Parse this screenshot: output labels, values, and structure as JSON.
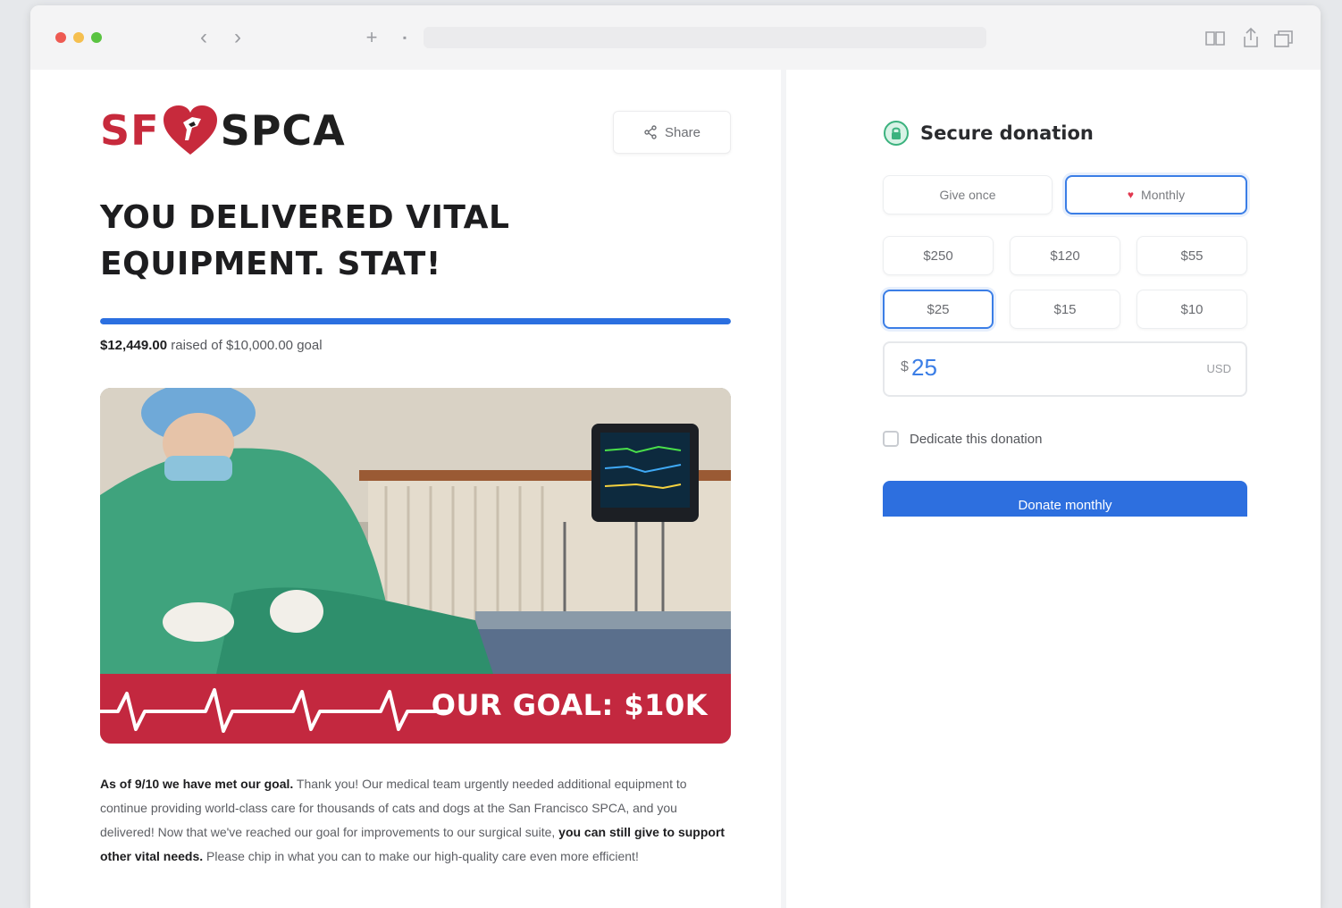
{
  "browser": {
    "traffic_lights": [
      "#ee5a52",
      "#f5bf4f",
      "#5ac341"
    ],
    "back_icon": "chevron-left",
    "forward_icon": "chevron-right",
    "reader_icon": "book",
    "share_icon": "share-up",
    "tabs_icon": "tabs"
  },
  "page": {
    "logo_sf": "SF",
    "logo_spca": "SPCA",
    "share_label": "Share",
    "headline": "YOU DELIVERED VITAL EQUIPMENT. STAT!",
    "progress_fraction": 1.0,
    "raised_amount": "$12,449.00",
    "raised_suffix": "raised of $10,000.00 goal",
    "goal_banner": "OUR GOAL: $10K",
    "body_bold_1": "As of 9/10 we have met our goal.",
    "body_1": " Thank you! Our medical team urgently needed additional equipment to continue providing world-class care for thousands of cats and dogs at the San Francisco SPCA, and you delivered! Now that we've reached our goal for improvements to our surgical suite, ",
    "body_bold_2": "you can still give to support other vital needs.",
    "body_2": " Please chip in what you can to make our high-quality care even more efficient!"
  },
  "donation": {
    "title": "Secure donation",
    "give_once": "Give once",
    "monthly": "Monthly",
    "amounts": [
      "$250",
      "$120",
      "$55",
      "$25",
      "$15",
      "$10"
    ],
    "selected_amount_index": 3,
    "currency_symbol": "$",
    "amount_value": "25",
    "currency_code": "USD",
    "dedicate_label": "Dedicate this donation",
    "donate_button": "Donate monthly",
    "accent_color": "#3b7ee6",
    "brand_red": "#c72a3c"
  }
}
